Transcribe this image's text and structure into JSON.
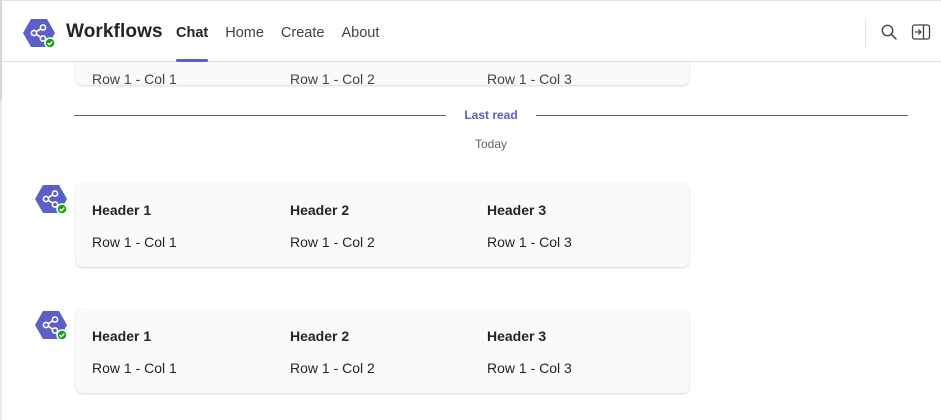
{
  "app": {
    "title": "Workflows",
    "icon": "workflows-share-icon",
    "accent_color": "#5b5fc7",
    "status_color": "#13a10e"
  },
  "tabs": [
    {
      "label": "Chat",
      "active": true
    },
    {
      "label": "Home",
      "active": false
    },
    {
      "label": "Create",
      "active": false
    },
    {
      "label": "About",
      "active": false
    }
  ],
  "header_actions": {
    "search_icon": "search-icon",
    "popout_icon": "pop-out-icon"
  },
  "chat": {
    "last_read_label": "Last read",
    "date_label": "Today",
    "previous_message": {
      "cells": [
        "Row 1 - Col 1",
        "Row 1 - Col 2",
        "Row 1 - Col 3"
      ]
    },
    "messages": [
      {
        "headers": [
          "Header 1",
          "Header 2",
          "Header 3"
        ],
        "rows": [
          [
            "Row 1 - Col 1",
            "Row 1 - Col 2",
            "Row 1 - Col 3"
          ]
        ]
      },
      {
        "headers": [
          "Header 1",
          "Header 2",
          "Header 3"
        ],
        "rows": [
          [
            "Row 1 - Col 1",
            "Row 1 - Col 2",
            "Row 1 - Col 3"
          ]
        ]
      }
    ]
  }
}
